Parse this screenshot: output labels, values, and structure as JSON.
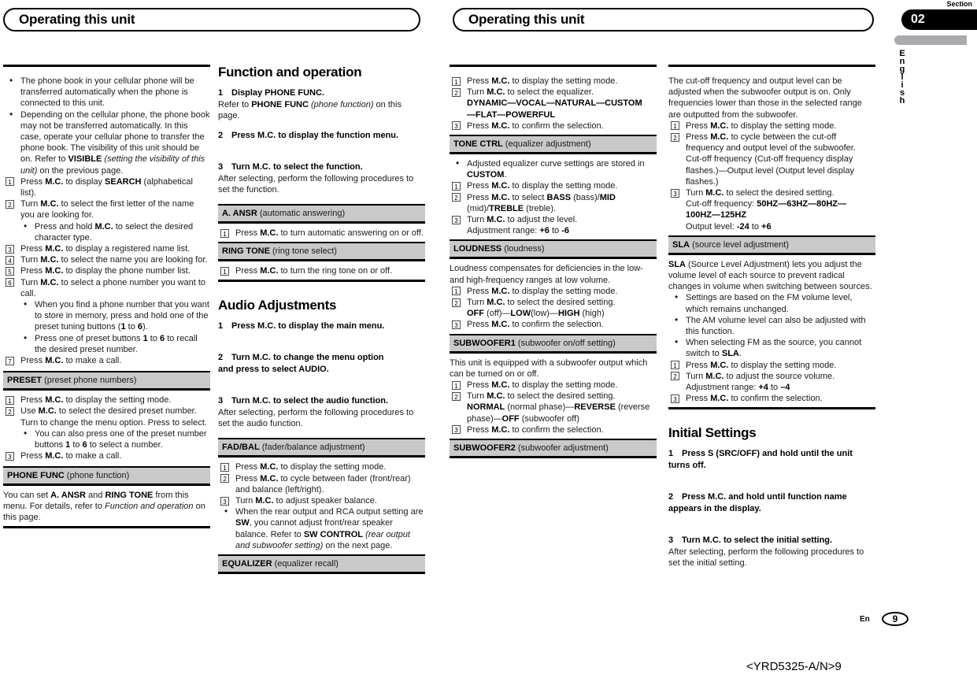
{
  "headers": {
    "left_title": "Operating this unit",
    "right_title": "Operating this unit"
  },
  "section_tab": {
    "label": "Section",
    "number": "02",
    "language": "English"
  },
  "footer": {
    "lang_code": "En",
    "page_number": "9",
    "doc_code": "<YRD5325-A/N>9"
  },
  "col1": {
    "bullets": [
      "The phone book in your cellular phone will be transferred automatically when the phone is connected to this unit.",
      "Depending on the cellular phone, the phone book may not be transferred automatically. In this case, operate your cellular phone to transfer the phone book. The visibility of this unit should be on. Refer to VISIBLE (setting the visibility of this unit) on the previous page."
    ],
    "bullet2_parts": {
      "pre": "Depending on the cellular phone, the phone book may not be transferred automatically. In this case, operate your cellular phone to transfer the phone book. The visibility of this unit should be on. Refer to ",
      "bold": "VISIBLE",
      "italic": " (setting the visibility of this unit)",
      "post": " on the previous page."
    },
    "steps": [
      {
        "n": "1",
        "text": "Press M.C. to display SEARCH (alphabetical list)."
      },
      {
        "n": "2",
        "text": "Turn M.C. to select the first letter of the name you are looking for."
      },
      {
        "n": "3",
        "text": "Press M.C. to display a registered name list."
      },
      {
        "n": "4",
        "text": "Turn M.C. to select the name you are looking for."
      },
      {
        "n": "5",
        "text": "Press M.C. to display the phone number list."
      },
      {
        "n": "6",
        "text": "Turn M.C. to select a phone number you want to call."
      },
      {
        "n": "7",
        "text": "Press M.C. to make a call."
      }
    ],
    "sub_bullet_after_2": "Press and hold M.C. to select the desired character type.",
    "sub_bullets_after_6": [
      "When you find a phone number that you want to store in memory, press and hold one of the preset tuning buttons (1 to 6).",
      "Press one of preset buttons 1 to 6 to recall the desired preset number."
    ],
    "preset_bar": {
      "name": "PRESET",
      "desc": "(preset phone numbers)"
    },
    "preset_steps": [
      {
        "n": "1",
        "text": "Press M.C. to display the setting mode."
      },
      {
        "n": "2",
        "text": "Use M.C. to select the desired preset number. Turn to change the menu option. Press to select."
      },
      {
        "n": "3",
        "text": "Press M.C. to make a call."
      }
    ],
    "preset_sub_bullet": "You can also press one of the preset number buttons 1 to 6 to select a number.",
    "phonefunc_bar": {
      "name": "PHONE FUNC",
      "desc": "(phone function)"
    },
    "phonefunc_body": "You can set A. ANSR and RING TONE from this menu. For details, refer to Function and operation on this page."
  },
  "col2": {
    "heading": "Function and operation",
    "steps": [
      {
        "n": "1",
        "title": "Display PHONE FUNC.",
        "body": "Refer to PHONE FUNC (phone function) on this page."
      },
      {
        "n": "2",
        "title": "Press M.C. to display the function menu.",
        "body": ""
      },
      {
        "n": "3",
        "title": "Turn M.C. to select the function.",
        "body": "After selecting, perform the following procedures to set the function."
      }
    ],
    "ansr_bar": {
      "name": "A. ANSR",
      "desc": "(automatic answering)"
    },
    "ansr_steps": [
      {
        "n": "1",
        "text": "Press M.C. to turn automatic answering on or off."
      }
    ],
    "ringtone_bar": {
      "name": "RING TONE",
      "desc": "(ring tone select)"
    },
    "ringtone_steps": [
      {
        "n": "1",
        "text": "Press M.C. to turn the ring tone on or off."
      }
    ],
    "audio_heading": "Audio Adjustments",
    "audio_steps": [
      {
        "n": "1",
        "title": "Press M.C. to display the main menu.",
        "body": ""
      },
      {
        "n": "2",
        "title": "Turn M.C. to change the menu option and press to select AUDIO.",
        "body": ""
      },
      {
        "n": "3",
        "title": "Turn M.C. to select the audio function.",
        "body": "After selecting, perform the following procedures to set the audio function."
      }
    ],
    "fadbal_bar": {
      "name": "FAD/BAL",
      "desc": "(fader/balance adjustment)"
    },
    "fadbal_steps": [
      {
        "n": "1",
        "text": "Press M.C. to display the setting mode."
      },
      {
        "n": "2",
        "text": "Press M.C. to cycle between fader (front/rear) and balance (left/right)."
      },
      {
        "n": "3",
        "text": "Turn M.C. to adjust speaker balance."
      }
    ],
    "fadbal_bullet": "When the rear output and RCA output setting are SW, you cannot adjust front/rear speaker balance. Refer to SW CONTROL (rear output and subwoofer setting) on the next page.",
    "equalizer_bar": {
      "name": "EQUALIZER",
      "desc": "(equalizer recall)"
    }
  },
  "col3": {
    "eq_steps": [
      {
        "n": "1",
        "text": "Press M.C. to display the setting mode."
      },
      {
        "n": "2",
        "text": "Turn M.C. to select the equalizer."
      },
      {
        "n": "3",
        "text": "Press M.C. to confirm the selection."
      }
    ],
    "eq_options_line1": "DYNAMIC—VOCAL—NATURAL—CUSTOM",
    "eq_options_line2": "—FLAT—POWERFUL",
    "tonectrl_bar": {
      "name": "TONE CTRL",
      "desc": "(equalizer adjustment)"
    },
    "tonectrl_bullet": "Adjusted equalizer curve settings are stored in CUSTOM.",
    "tonectrl_steps": [
      {
        "n": "1",
        "text": "Press M.C. to display the setting mode."
      },
      {
        "n": "2",
        "text": "Press M.C. to select BASS (bass)/MID (mid)/TREBLE (treble)."
      },
      {
        "n": "3",
        "text": "Turn M.C. to adjust the level."
      }
    ],
    "tonectrl_range": "Adjustment range: +6 to -6",
    "loudness_bar": {
      "name": "LOUDNESS",
      "desc": "(loudness)"
    },
    "loudness_body": "Loudness compensates for deficiencies in the low- and high-frequency ranges at low volume.",
    "loudness_steps": [
      {
        "n": "1",
        "text": "Press M.C. to display the setting mode."
      },
      {
        "n": "2",
        "text": "Turn M.C. to select the desired setting."
      },
      {
        "n": "3",
        "text": "Press M.C. to confirm the selection."
      }
    ],
    "loudness_options": "OFF (off)—LOW(low)—HIGH (high)",
    "sub1_bar": {
      "name": "SUBWOOFER1",
      "desc": "(subwoofer on/off setting)"
    },
    "sub1_body": "This unit is equipped with a subwoofer output which can be turned on or off.",
    "sub1_steps": [
      {
        "n": "1",
        "text": "Press M.C. to display the setting mode."
      },
      {
        "n": "2",
        "text": "Turn M.C. to select the desired setting."
      },
      {
        "n": "3",
        "text": "Press M.C. to confirm the selection."
      }
    ],
    "sub1_options": "NORMAL (normal phase)—REVERSE (reverse phase)—OFF (subwoofer off)",
    "sub2_bar": {
      "name": "SUBWOOFER2",
      "desc": "(subwoofer adjustment)"
    }
  },
  "col4": {
    "sub2_body": "The cut-off frequency and output level can be adjusted when the subwoofer output is on. Only frequencies lower than those in the selected range are outputted from the subwoofer.",
    "sub2_steps": [
      {
        "n": "1",
        "text": "Press M.C. to display the setting mode."
      },
      {
        "n": "2",
        "text": "Press M.C. to cycle between the cut-off frequency and output level of the subwoofer."
      },
      {
        "n": "3",
        "text": "Turn M.C. to select the desired setting."
      }
    ],
    "sub2_step2_extra": "Cut-off frequency (Cut-off frequency display flashes.)—Output level (Output level display flashes.)",
    "sub2_cutoff_label": "Cut-off frequency: ",
    "sub2_cutoff_values_line1": "50HZ—63HZ—80HZ—",
    "sub2_cutoff_values_line2": "100HZ—125HZ",
    "sub2_output_label": "Output level: ",
    "sub2_output_min": "-24",
    "sub2_output_max": "+6",
    "sla_bar": {
      "name": "SLA",
      "desc": "(source level adjustment)"
    },
    "sla_body": "SLA (Source Level Adjustment) lets you adjust the volume level of each source to prevent radical changes in volume when switching between sources.",
    "sla_bullets": [
      "Settings are based on the FM volume level, which remains unchanged.",
      "The AM volume level can also be adjusted with this function.",
      "When selecting FM as the source, you cannot switch to SLA."
    ],
    "sla_steps": [
      {
        "n": "1",
        "text": "Press M.C. to display the setting mode."
      },
      {
        "n": "2",
        "text": "Turn M.C. to adjust the source volume."
      },
      {
        "n": "3",
        "text": "Press M.C. to confirm the selection."
      }
    ],
    "sla_range": "Adjustment range: +4 to –4",
    "initial_heading": "Initial Settings",
    "initial_steps": [
      {
        "n": "1",
        "title": "Press S (SRC/OFF) and hold until the unit turns off.",
        "body": ""
      },
      {
        "n": "2",
        "title": "Press M.C. and hold until function name appears in the display.",
        "body": ""
      },
      {
        "n": "3",
        "title": "Turn M.C. to select the initial setting.",
        "body": "After selecting, perform the following procedures to set the initial setting."
      }
    ]
  }
}
